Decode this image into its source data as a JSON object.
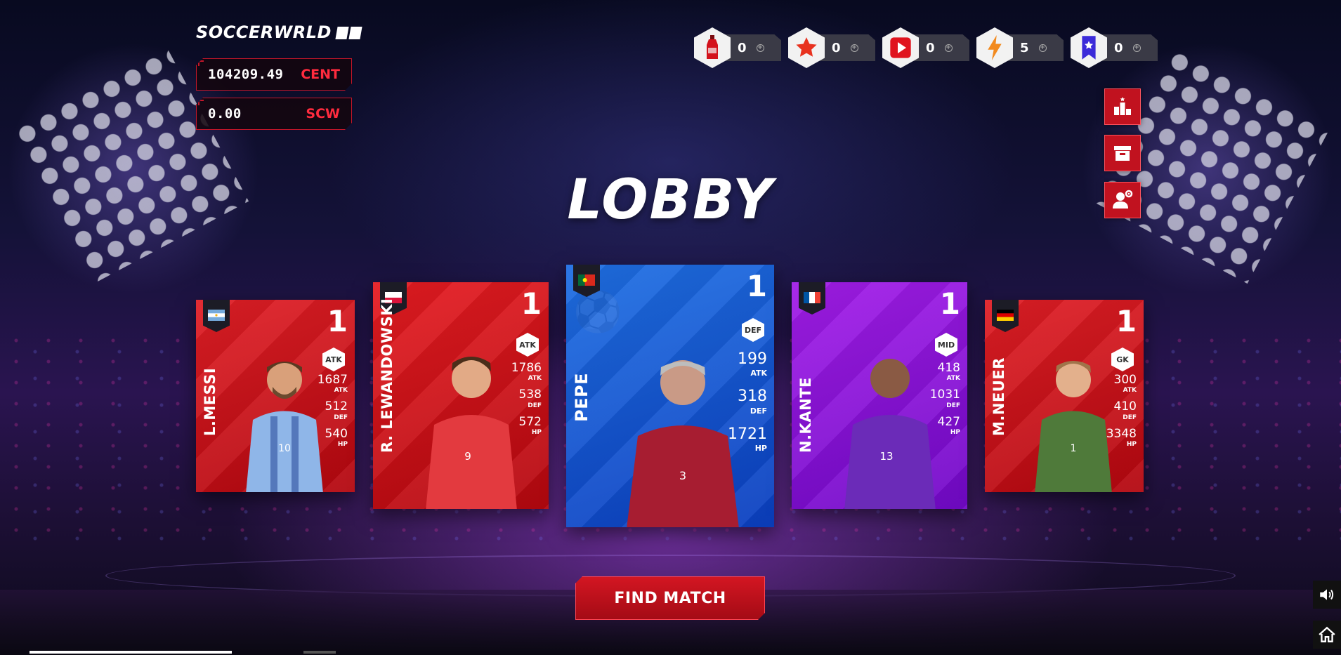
{
  "app": {
    "logo_text": "SOCCERWRLD",
    "title": "LOBBY"
  },
  "balances": [
    {
      "amount": "104209.49",
      "currency": "CENT"
    },
    {
      "amount": "0.00",
      "currency": "SCW"
    }
  ],
  "resources": [
    {
      "icon": "bottle-icon",
      "count": "0"
    },
    {
      "icon": "star-icon",
      "count": "0"
    },
    {
      "icon": "play-icon",
      "count": "0"
    },
    {
      "icon": "lightning-icon",
      "count": "5"
    },
    {
      "icon": "badge-icon",
      "count": "0"
    }
  ],
  "side_buttons": [
    {
      "icon": "leaderboard-icon"
    },
    {
      "icon": "inventory-box-icon"
    },
    {
      "icon": "profile-settings-icon"
    }
  ],
  "cards": [
    {
      "name": "L.MESSI",
      "level": "1",
      "position": "ATK",
      "atk": "1687",
      "def": "512",
      "hp": "540",
      "flag": "argentina",
      "jersey": "10"
    },
    {
      "name": "R. LEWANDOWSKI",
      "level": "1",
      "position": "ATK",
      "atk": "1786",
      "def": "538",
      "hp": "572",
      "flag": "poland",
      "jersey": "9"
    },
    {
      "name": "PEPE",
      "level": "1",
      "position": "DEF",
      "atk": "199",
      "def": "318",
      "hp": "1721",
      "flag": "portugal",
      "jersey": "3"
    },
    {
      "name": "N.KANTE",
      "level": "1",
      "position": "MID",
      "atk": "418",
      "def": "1031",
      "hp": "427",
      "flag": "france",
      "jersey": "13"
    },
    {
      "name": "M.NEUER",
      "level": "1",
      "position": "GK",
      "atk": "300",
      "def": "410",
      "hp": "3348",
      "flag": "germany",
      "jersey": "1"
    }
  ],
  "stat_labels": {
    "atk": "ATK",
    "def": "DEF",
    "hp": "HP"
  },
  "actions": {
    "find_match": "FIND MATCH"
  },
  "colors": {
    "accent_red": "#c1121f",
    "currency_red": "#ff2b3e",
    "card_red": "#e01f26",
    "card_blue": "#1f6fe3",
    "card_purple": "#a21de8"
  }
}
